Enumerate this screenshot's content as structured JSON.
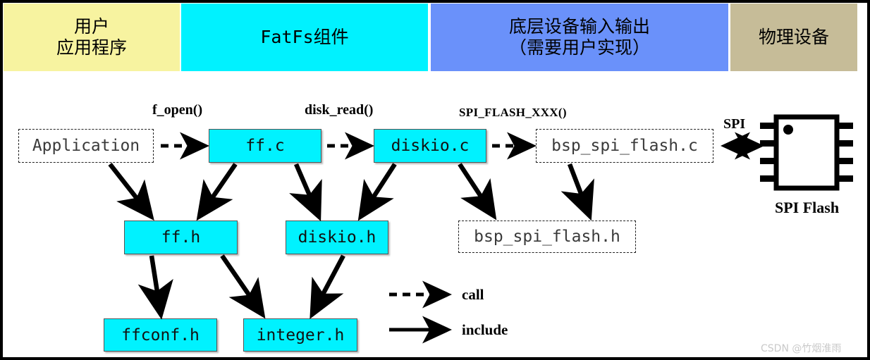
{
  "header": {
    "bands": [
      {
        "id": "user-app",
        "label": "用户\n应用程序",
        "color": "#F7F3A0",
        "style": "cn"
      },
      {
        "id": "fatfs",
        "label": "FatFs组件",
        "color": "#00F2FF",
        "style": "mono"
      },
      {
        "id": "lowlevel",
        "label": "底层设备输入输出\n（需要用户实现）",
        "color": "#6A91FA",
        "style": "cn"
      },
      {
        "id": "physical",
        "label": "物理设备",
        "color": "#C6BC98",
        "style": "cn"
      }
    ]
  },
  "nodes": [
    {
      "id": "application",
      "label": "Application",
      "kind": "dashed"
    },
    {
      "id": "ff-c",
      "label": "ff.c",
      "kind": "solid"
    },
    {
      "id": "diskio-c",
      "label": "diskio.c",
      "kind": "solid"
    },
    {
      "id": "bsp-spi-flash-c",
      "label": "bsp_spi_flash.c",
      "kind": "dashed"
    },
    {
      "id": "ff-h",
      "label": "ff.h",
      "kind": "solid"
    },
    {
      "id": "diskio-h",
      "label": "diskio.h",
      "kind": "solid"
    },
    {
      "id": "bsp-spi-flash-h",
      "label": "bsp_spi_flash.h",
      "kind": "dashed"
    },
    {
      "id": "ffconf-h",
      "label": "ffconf.h",
      "kind": "solid"
    },
    {
      "id": "integer-h",
      "label": "integer.h",
      "kind": "solid"
    }
  ],
  "call_labels": [
    {
      "id": "f-open",
      "label": "f_open()"
    },
    {
      "id": "disk-read",
      "label": "disk_read()"
    },
    {
      "id": "spi-flash-xxx",
      "label": "SPI_FLASH_XXX()"
    },
    {
      "id": "spi",
      "label": "SPI"
    }
  ],
  "chip": {
    "label": "SPI Flash",
    "pins_per_side": 4
  },
  "legend": {
    "call_label": "call",
    "include_label": "include"
  },
  "watermark": {
    "text": "CSDN @竹烟淮雨"
  },
  "colors": {
    "node_fill": "#00F2FF",
    "band_yellow": "#F7F3A0",
    "band_cyan": "#00F2FF",
    "band_blue": "#6A91FA",
    "band_tan": "#C6BC98",
    "stroke": "#000000",
    "watermark": "#c9c9c9"
  }
}
